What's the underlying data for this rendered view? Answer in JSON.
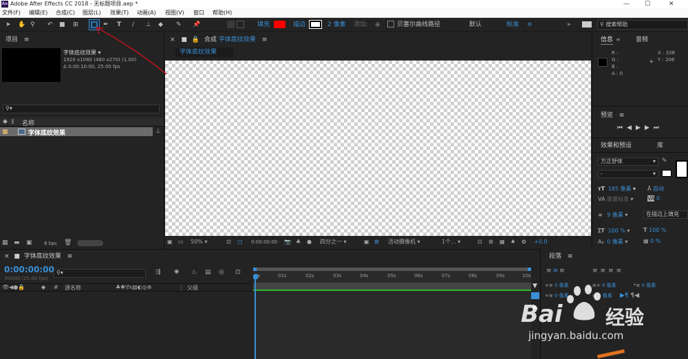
{
  "titlebar": {
    "title": "Adobe After Effects CC 2018 - 无标题项目.aep *",
    "app_icon": "Ae",
    "minimize": "—",
    "maximize": "☐",
    "close": "✕"
  },
  "menu": [
    "文件(F)",
    "编辑(E)",
    "合成(C)",
    "图层(L)",
    "效果(T)",
    "动画(A)",
    "视图(V)",
    "窗口",
    "帮助(H)"
  ],
  "toolbar": {
    "fill_label": "填充",
    "fill_color": "#ff0000",
    "stroke_label": "描边",
    "stroke_width": "2 像素",
    "bezier_label": "贝塞尔曲线路径",
    "workspace_default": "默认",
    "workspace_standard": "标准",
    "search_placeholder": "搜索帮助"
  },
  "project": {
    "tab": "项目",
    "comp_name": "字体底纹效果",
    "comp_res": "1920 x1080  (480 x270) (1.00)",
    "comp_dur": "Δ 0:00:10:00, 25.00 fps",
    "col_name": "名称",
    "item_name": "字体底纹效果",
    "bpc": "8 bpc"
  },
  "composition": {
    "tab_prefix": "合成",
    "tab_name": "字体底纹效果",
    "subtab": "字体底纹效果",
    "zoom": "50%",
    "timecode": "0:00:00:00",
    "resolution": "四分之一",
    "camera": "活动摄像机",
    "views": "1个...",
    "exposure": "+0.0"
  },
  "info": {
    "tab": "信息",
    "audio_tab": "音频",
    "r": "R :",
    "g": "G :",
    "b": "B :",
    "a": "A :  0",
    "x": "X : 338",
    "y": "Y : 206"
  },
  "preview": {
    "tab": "预览"
  },
  "effects": {
    "tab": "效果和预设",
    "lib_tab": "库"
  },
  "character": {
    "font": "方正舒体",
    "style": "-",
    "size": "185 像素",
    "leading": "自动",
    "kerning": "度量标准",
    "tracking": "0",
    "stroke": "9 像素",
    "stroke_mode": "在描边上填充",
    "vscale": "100 %",
    "hscale": "100 %",
    "baseline": "0 像素",
    "tsume": "0 %"
  },
  "paragraph": {
    "tab": "段落",
    "indent1": "0 像素",
    "indent2": "0 像素",
    "indent3": "0 像素",
    "space1": "0 像素",
    "space2": "0 像素"
  },
  "timeline": {
    "tab": "字体底纹效果",
    "timecode": "0:00:00:00",
    "frames": "00000 (25.00 fps)",
    "col_source": "源名称",
    "col_parent": "父级",
    "ruler": [
      "0s",
      "01s",
      "02s",
      "03s",
      "04s",
      "05s",
      "06s",
      "07s",
      "08s",
      "09s",
      "10s"
    ]
  },
  "watermark": {
    "brand": "Bai",
    "brand_cn": "经验",
    "url": "jingyan.baidu.com"
  },
  "colors": {
    "accent": "#3a8fd6",
    "annotation": "#c0141b",
    "green": "#2fb82f"
  }
}
